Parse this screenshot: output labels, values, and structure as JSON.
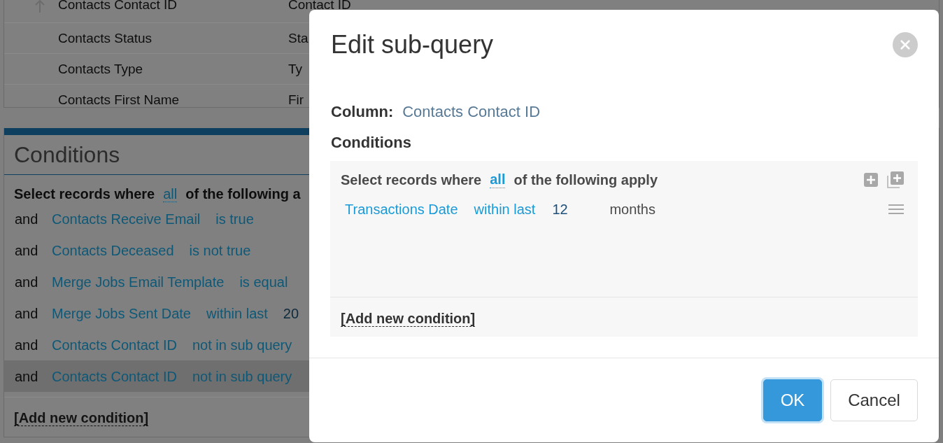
{
  "columns_list": {
    "rows": [
      {
        "column_1": "Contacts Contact ID",
        "column_2": "Contact ID",
        "sorted": true
      },
      {
        "column_1": "Contacts Status",
        "column_2": "Sta",
        "sorted": false
      },
      {
        "column_1": "Contacts Type",
        "column_2": "Ty",
        "sorted": false
      },
      {
        "column_1": "Contacts First Name",
        "column_2": "Fir",
        "sorted": false
      }
    ]
  },
  "conditions_panel": {
    "title": "Conditions",
    "header": {
      "prefix": "Select records where",
      "mode": "all",
      "suffix": "of the following a"
    },
    "rows": [
      {
        "joiner": "and",
        "field": "Contacts Receive Email",
        "operator": "is true",
        "selected": false
      },
      {
        "joiner": "and",
        "field": "Contacts Deceased",
        "operator": "is not true",
        "selected": false
      },
      {
        "joiner": "and",
        "field": "Merge Jobs Email Template",
        "operator": "is equal",
        "selected": false
      },
      {
        "joiner": "and",
        "field": "Merge Jobs Sent Date",
        "operator": "within last",
        "value": "20",
        "selected": false
      },
      {
        "joiner": "and",
        "field": "Contacts Contact ID",
        "operator": "not in sub query",
        "selected": false
      },
      {
        "joiner": "and",
        "field": "Contacts Contact ID",
        "operator": "not in sub query",
        "selected": true
      }
    ],
    "add_link": "[Add new condition]"
  },
  "dialog": {
    "title": "Edit sub-query",
    "column_label": "Column:",
    "column_value": "Contacts Contact ID",
    "conditions_label": "Conditions",
    "group": {
      "prefix": "Select records where",
      "mode": "all",
      "suffix": "of the following apply",
      "conditions": [
        {
          "field": "Transactions Date",
          "operator": "within last",
          "value": "12",
          "unit": "months"
        }
      ],
      "add_link": "[Add new condition]"
    },
    "buttons": [
      {
        "label": "OK",
        "kind": "primary",
        "focused": true
      },
      {
        "label": "Cancel",
        "kind": "default",
        "focused": false
      }
    ]
  }
}
